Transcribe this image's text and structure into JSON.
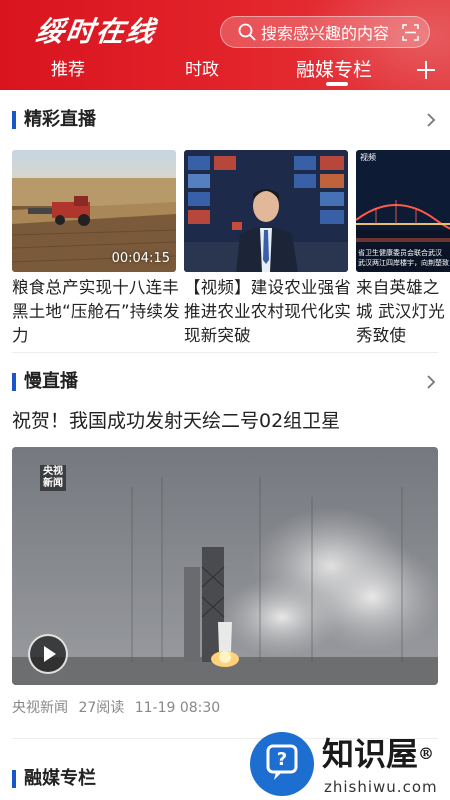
{
  "header": {
    "logo_text": "绥时在线",
    "search_placeholder": "搜索感兴趣的内容",
    "tabs": [
      {
        "label": "推荐"
      },
      {
        "label": "时政"
      },
      {
        "label": "融媒专栏"
      }
    ],
    "active_tab": "融媒专栏",
    "colors": {
      "brand_red": "#e3242b",
      "accent_blue": "#1a56c8"
    }
  },
  "section_live": {
    "title": "精彩直播",
    "cards": [
      {
        "title": "粮食总产实现十八连丰 黑土地“压舱石”持续发力",
        "duration": "00:04:15",
        "thumb": "farm-harvest-image"
      },
      {
        "title": "【视频】建设农业强省 推进农业农村现代化实现新突破",
        "duration": "",
        "thumb": "news-anchor-image"
      },
      {
        "title": "来自英雄之城 武汉灯光秀致使",
        "duration": "",
        "thumb": "wuhan-bridge-night-image",
        "overlay_lines": [
          "省卫生健康委员会联合武汉",
          "武汉两江四岸楼宇，向荆楚致"
        ],
        "corner_label": "视频"
      }
    ]
  },
  "section_slow": {
    "title": "慢直播",
    "headline": "祝贺！我国成功发射天绘二号02组卫星",
    "video": {
      "badge": "央视新闻",
      "thumb": "rocket-launch-image"
    },
    "meta": {
      "source": "央视新闻",
      "reads": "27阅读",
      "time": "11-19 08:30"
    }
  },
  "section_column": {
    "title": "融媒专栏"
  },
  "watermark": {
    "title": "知识屋",
    "subtitle": "zhishiwu.com",
    "registered": "®"
  }
}
